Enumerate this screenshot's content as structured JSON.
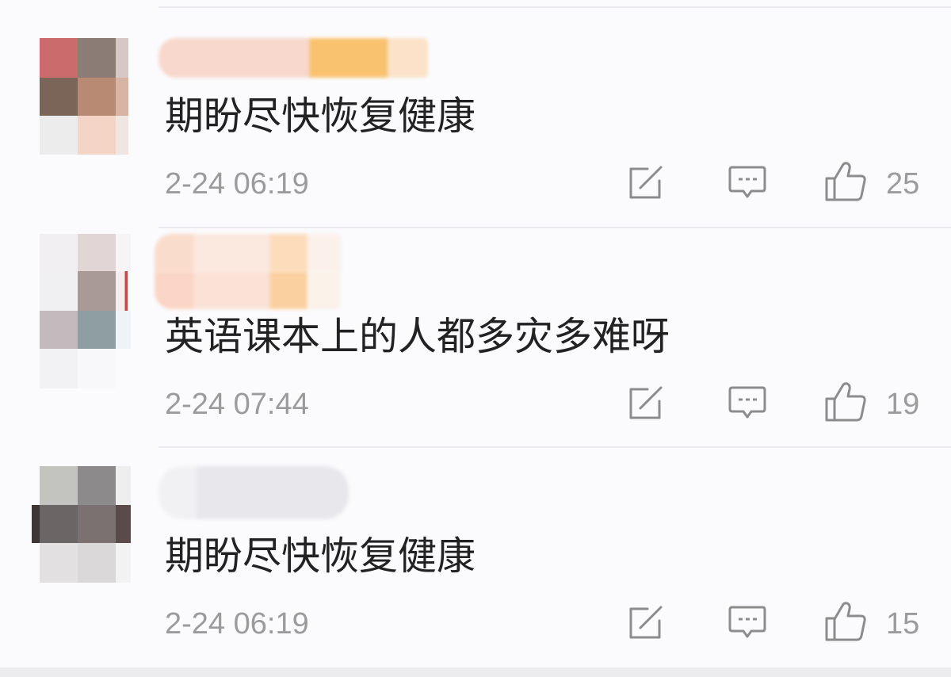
{
  "comments": [
    {
      "text": "期盼尽快恢复健康",
      "time": "2-24 06:19",
      "likes": "25"
    },
    {
      "text": "英语课本上的人都多灾多难呀",
      "time": "2-24 07:44",
      "likes": "19"
    },
    {
      "text": "期盼尽快恢复健康",
      "time": "2-24 06:19",
      "likes": "15"
    }
  ],
  "icons": {
    "forward": "forward-icon",
    "comment": "comment-icon",
    "like": "thumbs-up-icon"
  },
  "colors": {
    "text": "#222222",
    "meta": "#9b9b9b",
    "icon": "#8c8c8c",
    "divider": "#ebebef",
    "background": "#fbfbfd"
  }
}
